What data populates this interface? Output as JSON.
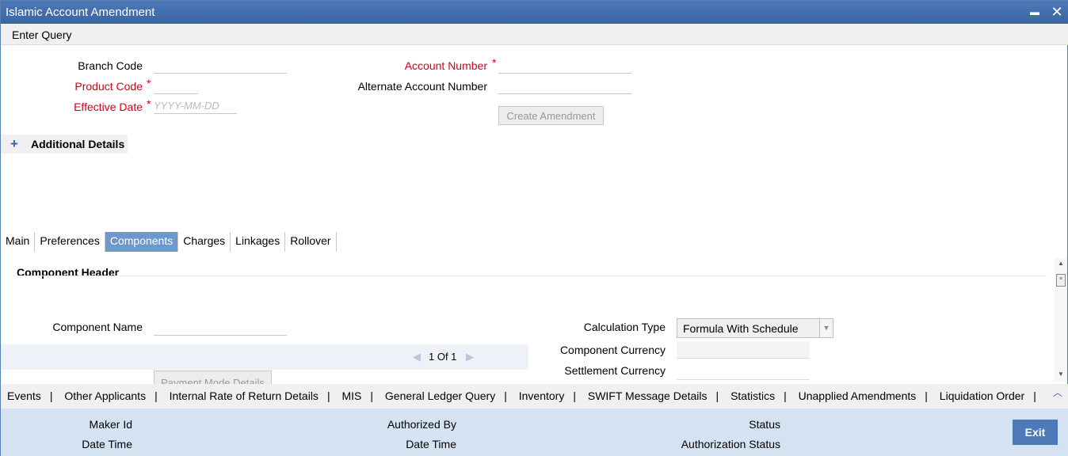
{
  "window": {
    "title": "Islamic Account Amendment",
    "minimize": "▬",
    "close": "✕"
  },
  "toolbar": {
    "enter_query": "Enter Query"
  },
  "form": {
    "branch_code_label": "Branch Code",
    "product_code_label": "Product Code",
    "effective_date_label": "Effective Date",
    "effective_date_placeholder": "YYYY-MM-DD",
    "account_number_label": "Account Number",
    "alt_account_number_label": "Alternate Account Number",
    "required_mark": "*",
    "create_amendment": "Create Amendment"
  },
  "additional": {
    "plus": "+",
    "label": "Additional Details"
  },
  "tabs": [
    {
      "label": "Main"
    },
    {
      "label": "Preferences"
    },
    {
      "label": "Components",
      "active": true
    },
    {
      "label": "Charges"
    },
    {
      "label": "Linkages"
    },
    {
      "label": "Rollover"
    }
  ],
  "components": {
    "header": "Component Header",
    "component_name_label": "Component Name",
    "calculation_type_label": "Calculation Type",
    "calculation_type_value": "Formula With Schedule",
    "component_currency_label": "Component Currency",
    "settlement_currency_label": "Settlement Currency",
    "pager": "1 Of 1",
    "payment_mode_button": "Payment Mode Details"
  },
  "links": [
    "Events",
    "Other Applicants",
    "Internal Rate of Return Details",
    "MIS",
    "General Ledger Query",
    "Inventory",
    "SWIFT Message Details",
    "Statistics",
    "Unapplied Amendments",
    "Liquidation Order"
  ],
  "footer": {
    "maker_id": "Maker Id",
    "date_time_1": "Date Time",
    "authorized_by": "Authorized By",
    "date_time_2": "Date Time",
    "status": "Status",
    "authorization_status": "Authorization Status",
    "exit": "Exit"
  },
  "colors": {
    "titlebar": "#4d79b8",
    "active_tab": "#6c98cf",
    "required": "#d0021b",
    "footer": "#d4e2f2"
  }
}
